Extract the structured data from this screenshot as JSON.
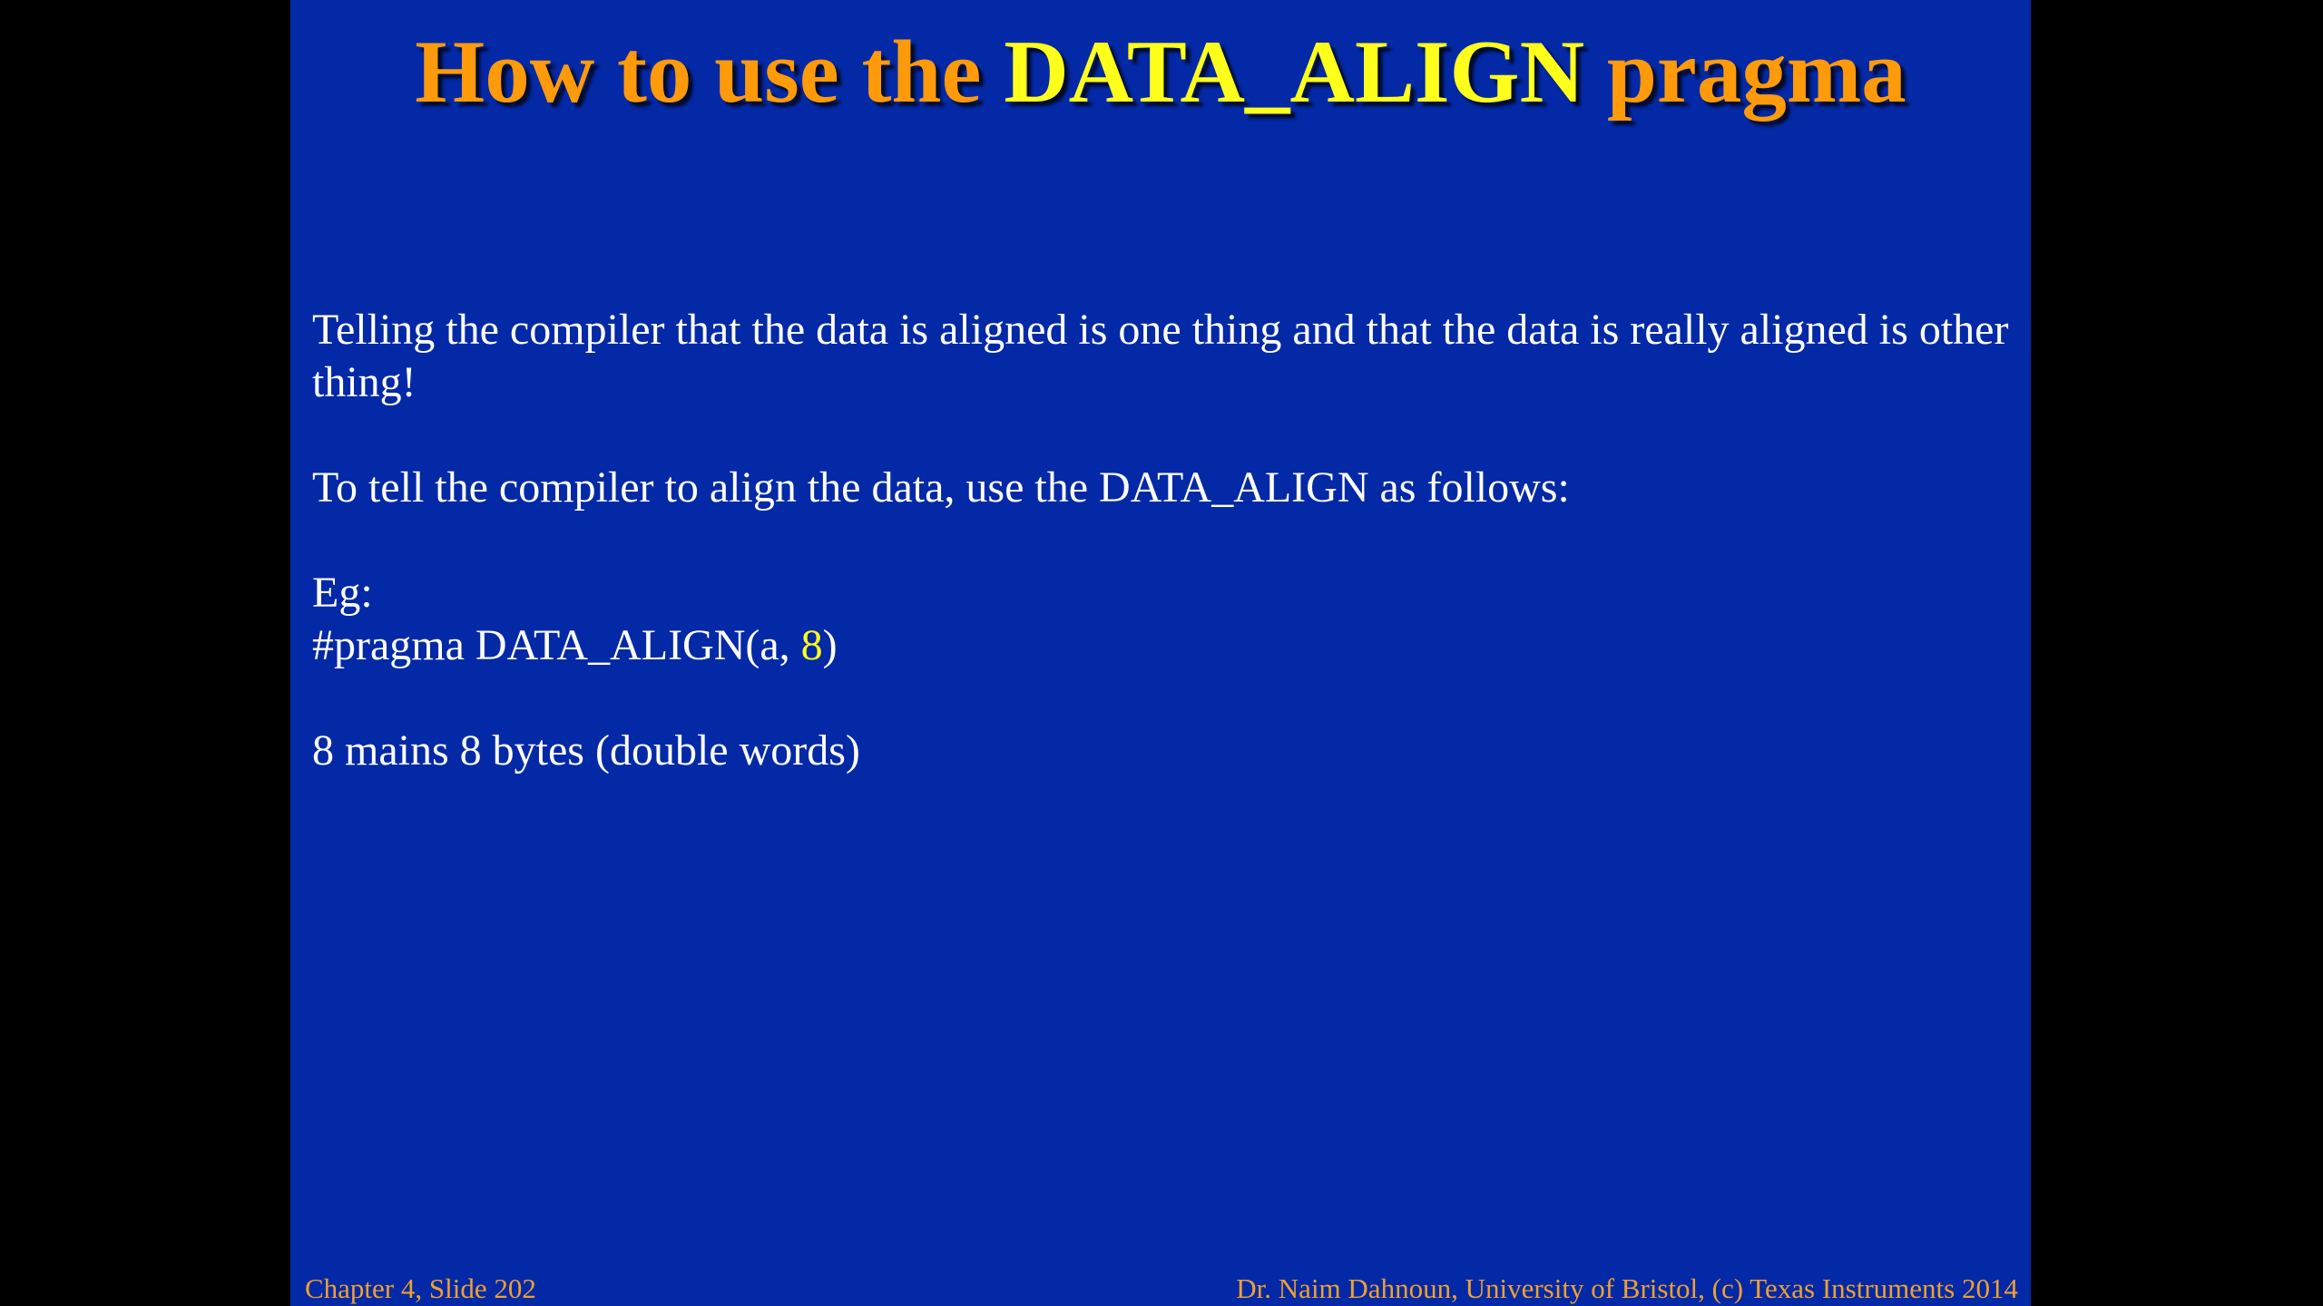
{
  "slide": {
    "title": {
      "part1": "How to use the ",
      "part2": "DATA_ALIGN",
      "part3": " pragma"
    },
    "body": {
      "paragraph1": "Telling the compiler that the data is aligned is one thing and that the data is really aligned is other thing!",
      "paragraph2": "To tell the compiler to align the data, use the DATA_ALIGN as follows:",
      "eg_label": "Eg:",
      "code_prefix": "#pragma DATA_ALIGN(a, ",
      "code_value": "8",
      "code_suffix": ")",
      "paragraph3": "8 mains 8 bytes (double words)"
    },
    "footer": {
      "left": "Chapter 4, Slide 202",
      "right": "Dr. Naim Dahnoun, University of Bristol,  (c) Texas Instruments 2014"
    }
  },
  "colors": {
    "slide_background": "#0329a6",
    "title_orange": "#ff9a0a",
    "title_yellow": "#ffff1c",
    "body_text": "#ffffff",
    "footer_text": "#f0a030"
  }
}
